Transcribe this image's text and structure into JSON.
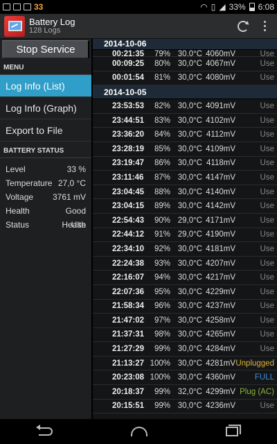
{
  "statusbar": {
    "notif_count": "33",
    "battery": "33%",
    "time": "6:08"
  },
  "app": {
    "title": "Battery Log",
    "subtitle": "128 Logs"
  },
  "sidebar": {
    "stop_label": "Stop Service",
    "menu_title": "MENU",
    "menu": [
      "Log Info (List)",
      "Log Info (Graph)",
      "Export to File"
    ],
    "status_title": "BATTERY STATUS",
    "status": [
      {
        "k": "Level",
        "v": "33 %"
      },
      {
        "k": "Temperature",
        "v": "27,0 °C"
      },
      {
        "k": "Voltage",
        "v": "3761 mV"
      },
      {
        "k": "Health",
        "v": "Good Health"
      },
      {
        "k": "Status",
        "v": "Use"
      }
    ]
  },
  "log": {
    "groups": [
      {
        "date": "2014-10-06",
        "rows": [
          {
            "time": "00:21:35",
            "level": "79%",
            "temp": "30,0°C",
            "volt": "4060mV",
            "state": "Use"
          },
          {
            "time": "00:09:25",
            "level": "80%",
            "temp": "30,0°C",
            "volt": "4067mV",
            "state": "Use"
          },
          {
            "time": "00:01:54",
            "level": "81%",
            "temp": "30,0°C",
            "volt": "4080mV",
            "state": "Use"
          }
        ]
      },
      {
        "date": "2014-10-05",
        "rows": [
          {
            "time": "23:53:53",
            "level": "82%",
            "temp": "30,0°C",
            "volt": "4091mV",
            "state": "Use"
          },
          {
            "time": "23:44:51",
            "level": "83%",
            "temp": "30,0°C",
            "volt": "4102mV",
            "state": "Use"
          },
          {
            "time": "23:36:20",
            "level": "84%",
            "temp": "30,0°C",
            "volt": "4112mV",
            "state": "Use"
          },
          {
            "time": "23:28:19",
            "level": "85%",
            "temp": "30,0°C",
            "volt": "4109mV",
            "state": "Use"
          },
          {
            "time": "23:19:47",
            "level": "86%",
            "temp": "30,0°C",
            "volt": "4118mV",
            "state": "Use"
          },
          {
            "time": "23:11:46",
            "level": "87%",
            "temp": "30,0°C",
            "volt": "4147mV",
            "state": "Use"
          },
          {
            "time": "23:04:45",
            "level": "88%",
            "temp": "30,0°C",
            "volt": "4140mV",
            "state": "Use"
          },
          {
            "time": "23:04:15",
            "level": "89%",
            "temp": "30,0°C",
            "volt": "4142mV",
            "state": "Use"
          },
          {
            "time": "22:54:43",
            "level": "90%",
            "temp": "29,0°C",
            "volt": "4171mV",
            "state": "Use"
          },
          {
            "time": "22:44:12",
            "level": "91%",
            "temp": "29,0°C",
            "volt": "4190mV",
            "state": "Use"
          },
          {
            "time": "22:34:10",
            "level": "92%",
            "temp": "30,0°C",
            "volt": "4181mV",
            "state": "Use"
          },
          {
            "time": "22:24:38",
            "level": "93%",
            "temp": "30,0°C",
            "volt": "4207mV",
            "state": "Use"
          },
          {
            "time": "22:16:07",
            "level": "94%",
            "temp": "30,0°C",
            "volt": "4217mV",
            "state": "Use"
          },
          {
            "time": "22:07:36",
            "level": "95%",
            "temp": "30,0°C",
            "volt": "4229mV",
            "state": "Use"
          },
          {
            "time": "21:58:34",
            "level": "96%",
            "temp": "30,0°C",
            "volt": "4237mV",
            "state": "Use"
          },
          {
            "time": "21:47:02",
            "level": "97%",
            "temp": "30,0°C",
            "volt": "4258mV",
            "state": "Use"
          },
          {
            "time": "21:37:31",
            "level": "98%",
            "temp": "30,0°C",
            "volt": "4265mV",
            "state": "Use"
          },
          {
            "time": "21:27:29",
            "level": "99%",
            "temp": "30,0°C",
            "volt": "4284mV",
            "state": "Use"
          },
          {
            "time": "21:13:27",
            "level": "100%",
            "temp": "30,0°C",
            "volt": "4281mV",
            "state": "Unplugged"
          },
          {
            "time": "20:23:08",
            "level": "100%",
            "temp": "30,0°C",
            "volt": "4360mV",
            "state": "FULL"
          },
          {
            "time": "20:18:37",
            "level": "99%",
            "temp": "32,0°C",
            "volt": "4299mV",
            "state": "Plug (AC)"
          },
          {
            "time": "20:15:51",
            "level": "99%",
            "temp": "30,0°C",
            "volt": "4236mV",
            "state": "Use"
          }
        ]
      }
    ]
  },
  "colors": {
    "accent": "#2f9ec9",
    "unplugged": "#e0b23a",
    "full": "#3f8fd8",
    "plug": "#8fb43a"
  }
}
